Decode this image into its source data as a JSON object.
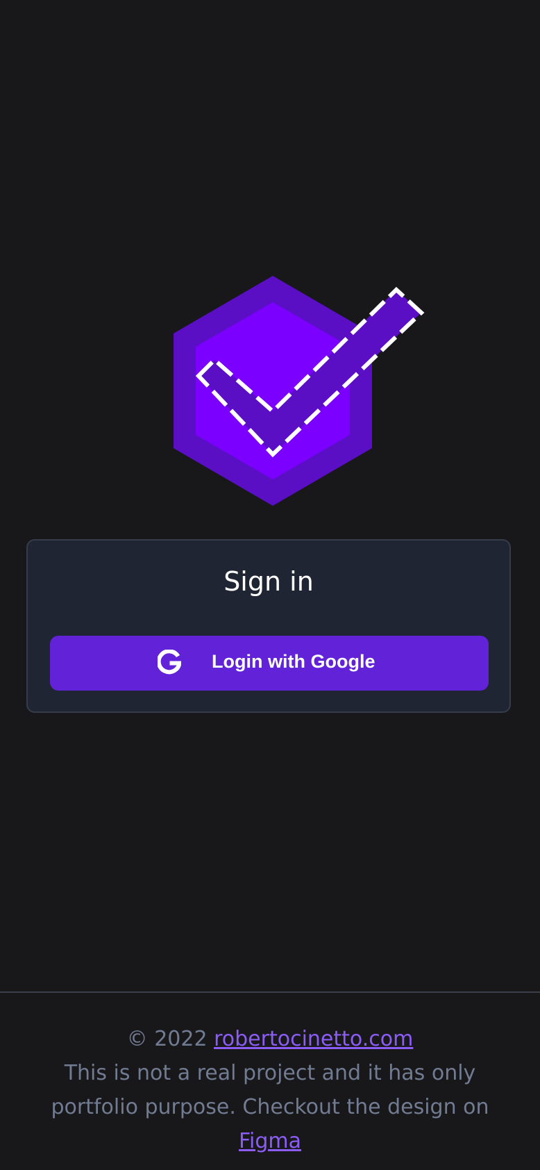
{
  "logo": {
    "icon": "hexagon-checkmark-icon",
    "outer_color": "#5b0fc4",
    "inner_color": "#7b00ff",
    "stroke_color": "#ffffff"
  },
  "signin": {
    "title": "Sign in",
    "google_button_label": "Login with Google",
    "google_icon": "google-g-icon",
    "button_color": "#6122d8"
  },
  "footer": {
    "copyright": "© 2022",
    "site_link": "robertocinetto.com",
    "disclaimer": "This is not a real project and it has only portfolio purpose. Checkout the design on",
    "figma_link": "Figma",
    "link_color": "#8b5cf6"
  }
}
